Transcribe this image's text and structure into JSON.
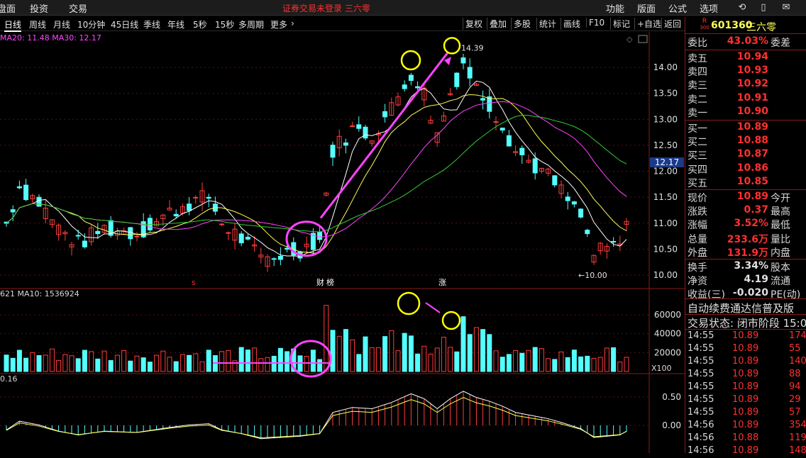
{
  "menu": {
    "items": [
      "盘面",
      "投资",
      "交易"
    ],
    "warning": "证券交易未登录  三六零",
    "right": [
      "功能",
      "版面",
      "公式",
      "选项"
    ]
  },
  "periods": [
    "日线",
    "周线",
    "月线",
    "10分钟",
    "45日线",
    "季线",
    "年线",
    "5秒",
    "15秒",
    "多周期",
    "更多"
  ],
  "tools": [
    "复权",
    "叠加",
    "多股",
    "统计",
    "画线",
    "F10",
    "标记",
    "+自选",
    "返回"
  ],
  "chart": {
    "ma_text_main": "MA20: 11.48  MA30: 12.17",
    "high_label": "14.39",
    "low_label": "10.00",
    "current_price_tag": "12.17",
    "price_axis": [
      "14.00",
      "13.50",
      "13.00",
      "12.50",
      "12.00",
      "11.50",
      "11.00",
      "10.50",
      "10.00"
    ],
    "vol_text": "621  MA10: 1536924",
    "vol_axis": [
      "60000",
      "40000",
      "20000"
    ],
    "vol_unit": "X100",
    "macd_text": "0.16",
    "macd_axis": [
      "0.50",
      "0.00"
    ],
    "event_marks": [
      "s",
      "财",
      "榜",
      "涨"
    ],
    "colors": {
      "up": "#ff3d3d",
      "down": "#54ffff",
      "ma5": "#ffffff",
      "ma10": "#ffff55",
      "ma20": "#ff44ff",
      "ma30": "#33cc33",
      "annot": "#ff44ff",
      "circle": "#ffff00"
    }
  },
  "quote": {
    "badge": "R",
    "badge_sub": "300",
    "code": "601360",
    "name": "三六零",
    "weibi_label": "委比",
    "weibi": "43.03%",
    "weicha_label": "委差",
    "asks": [
      {
        "l": "卖五",
        "p": "10.94"
      },
      {
        "l": "卖四",
        "p": "10.93"
      },
      {
        "l": "卖三",
        "p": "10.92"
      },
      {
        "l": "卖二",
        "p": "10.91"
      },
      {
        "l": "卖一",
        "p": "10.90"
      }
    ],
    "bids": [
      {
        "l": "买一",
        "p": "10.89"
      },
      {
        "l": "买二",
        "p": "10.88"
      },
      {
        "l": "买三",
        "p": "10.87"
      },
      {
        "l": "买四",
        "p": "10.86"
      },
      {
        "l": "买五",
        "p": "10.85"
      }
    ],
    "stats": [
      {
        "l": "现价",
        "v": "10.89",
        "r": "今开"
      },
      {
        "l": "涨跌",
        "v": "0.37",
        "r": "最高"
      },
      {
        "l": "涨幅",
        "v": "3.52%",
        "r": "最低"
      },
      {
        "l": "总量",
        "v": "233.6万",
        "r": "量比"
      },
      {
        "l": "外盘",
        "v": "131.9万",
        "r": "内盘"
      }
    ],
    "stats2": [
      {
        "l": "换手",
        "v": "3.34%",
        "r": "股本"
      },
      {
        "l": "净资",
        "v": "4.19",
        "r": "流通"
      },
      {
        "l": "收益(三)",
        "v": "-0.020",
        "r": "PE(动)"
      }
    ],
    "ad": "自动续费通达信普及版",
    "status": "交易状态: 闭市阶段 15:0",
    "ticks": [
      {
        "t": "14:55",
        "p": "10.89",
        "v": "174"
      },
      {
        "t": "14:55",
        "p": "10.89",
        "v": "55"
      },
      {
        "t": "14:55",
        "p": "10.89",
        "v": "140"
      },
      {
        "t": "14:55",
        "p": "10.89",
        "v": "88"
      },
      {
        "t": "14:55",
        "p": "10.89",
        "v": "94"
      },
      {
        "t": "14:55",
        "p": "10.89",
        "v": "29"
      },
      {
        "t": "14:55",
        "p": "10.89",
        "v": "57"
      },
      {
        "t": "14:56",
        "p": "10.89",
        "v": "354"
      },
      {
        "t": "14:56",
        "p": "10.88",
        "v": "119"
      },
      {
        "t": "14:56",
        "p": "10.89",
        "v": "148"
      }
    ]
  }
}
